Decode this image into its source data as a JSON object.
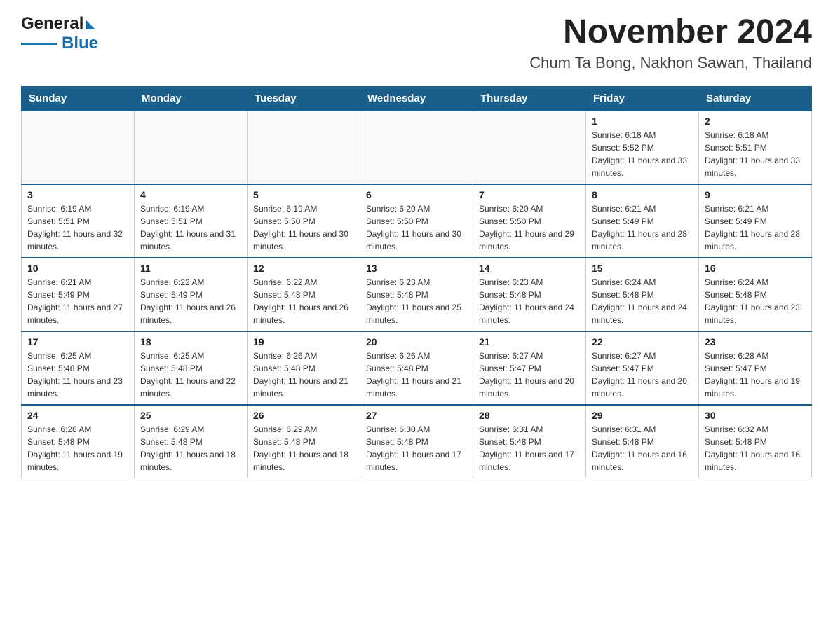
{
  "header": {
    "logo_general": "General",
    "logo_blue": "Blue",
    "title": "November 2024",
    "subtitle": "Chum Ta Bong, Nakhon Sawan, Thailand"
  },
  "calendar": {
    "days_of_week": [
      "Sunday",
      "Monday",
      "Tuesday",
      "Wednesday",
      "Thursday",
      "Friday",
      "Saturday"
    ],
    "weeks": [
      [
        {
          "day": "",
          "info": ""
        },
        {
          "day": "",
          "info": ""
        },
        {
          "day": "",
          "info": ""
        },
        {
          "day": "",
          "info": ""
        },
        {
          "day": "",
          "info": ""
        },
        {
          "day": "1",
          "info": "Sunrise: 6:18 AM\nSunset: 5:52 PM\nDaylight: 11 hours and 33 minutes."
        },
        {
          "day": "2",
          "info": "Sunrise: 6:18 AM\nSunset: 5:51 PM\nDaylight: 11 hours and 33 minutes."
        }
      ],
      [
        {
          "day": "3",
          "info": "Sunrise: 6:19 AM\nSunset: 5:51 PM\nDaylight: 11 hours and 32 minutes."
        },
        {
          "day": "4",
          "info": "Sunrise: 6:19 AM\nSunset: 5:51 PM\nDaylight: 11 hours and 31 minutes."
        },
        {
          "day": "5",
          "info": "Sunrise: 6:19 AM\nSunset: 5:50 PM\nDaylight: 11 hours and 30 minutes."
        },
        {
          "day": "6",
          "info": "Sunrise: 6:20 AM\nSunset: 5:50 PM\nDaylight: 11 hours and 30 minutes."
        },
        {
          "day": "7",
          "info": "Sunrise: 6:20 AM\nSunset: 5:50 PM\nDaylight: 11 hours and 29 minutes."
        },
        {
          "day": "8",
          "info": "Sunrise: 6:21 AM\nSunset: 5:49 PM\nDaylight: 11 hours and 28 minutes."
        },
        {
          "day": "9",
          "info": "Sunrise: 6:21 AM\nSunset: 5:49 PM\nDaylight: 11 hours and 28 minutes."
        }
      ],
      [
        {
          "day": "10",
          "info": "Sunrise: 6:21 AM\nSunset: 5:49 PM\nDaylight: 11 hours and 27 minutes."
        },
        {
          "day": "11",
          "info": "Sunrise: 6:22 AM\nSunset: 5:49 PM\nDaylight: 11 hours and 26 minutes."
        },
        {
          "day": "12",
          "info": "Sunrise: 6:22 AM\nSunset: 5:48 PM\nDaylight: 11 hours and 26 minutes."
        },
        {
          "day": "13",
          "info": "Sunrise: 6:23 AM\nSunset: 5:48 PM\nDaylight: 11 hours and 25 minutes."
        },
        {
          "day": "14",
          "info": "Sunrise: 6:23 AM\nSunset: 5:48 PM\nDaylight: 11 hours and 24 minutes."
        },
        {
          "day": "15",
          "info": "Sunrise: 6:24 AM\nSunset: 5:48 PM\nDaylight: 11 hours and 24 minutes."
        },
        {
          "day": "16",
          "info": "Sunrise: 6:24 AM\nSunset: 5:48 PM\nDaylight: 11 hours and 23 minutes."
        }
      ],
      [
        {
          "day": "17",
          "info": "Sunrise: 6:25 AM\nSunset: 5:48 PM\nDaylight: 11 hours and 23 minutes."
        },
        {
          "day": "18",
          "info": "Sunrise: 6:25 AM\nSunset: 5:48 PM\nDaylight: 11 hours and 22 minutes."
        },
        {
          "day": "19",
          "info": "Sunrise: 6:26 AM\nSunset: 5:48 PM\nDaylight: 11 hours and 21 minutes."
        },
        {
          "day": "20",
          "info": "Sunrise: 6:26 AM\nSunset: 5:48 PM\nDaylight: 11 hours and 21 minutes."
        },
        {
          "day": "21",
          "info": "Sunrise: 6:27 AM\nSunset: 5:47 PM\nDaylight: 11 hours and 20 minutes."
        },
        {
          "day": "22",
          "info": "Sunrise: 6:27 AM\nSunset: 5:47 PM\nDaylight: 11 hours and 20 minutes."
        },
        {
          "day": "23",
          "info": "Sunrise: 6:28 AM\nSunset: 5:47 PM\nDaylight: 11 hours and 19 minutes."
        }
      ],
      [
        {
          "day": "24",
          "info": "Sunrise: 6:28 AM\nSunset: 5:48 PM\nDaylight: 11 hours and 19 minutes."
        },
        {
          "day": "25",
          "info": "Sunrise: 6:29 AM\nSunset: 5:48 PM\nDaylight: 11 hours and 18 minutes."
        },
        {
          "day": "26",
          "info": "Sunrise: 6:29 AM\nSunset: 5:48 PM\nDaylight: 11 hours and 18 minutes."
        },
        {
          "day": "27",
          "info": "Sunrise: 6:30 AM\nSunset: 5:48 PM\nDaylight: 11 hours and 17 minutes."
        },
        {
          "day": "28",
          "info": "Sunrise: 6:31 AM\nSunset: 5:48 PM\nDaylight: 11 hours and 17 minutes."
        },
        {
          "day": "29",
          "info": "Sunrise: 6:31 AM\nSunset: 5:48 PM\nDaylight: 11 hours and 16 minutes."
        },
        {
          "day": "30",
          "info": "Sunrise: 6:32 AM\nSunset: 5:48 PM\nDaylight: 11 hours and 16 minutes."
        }
      ]
    ]
  }
}
